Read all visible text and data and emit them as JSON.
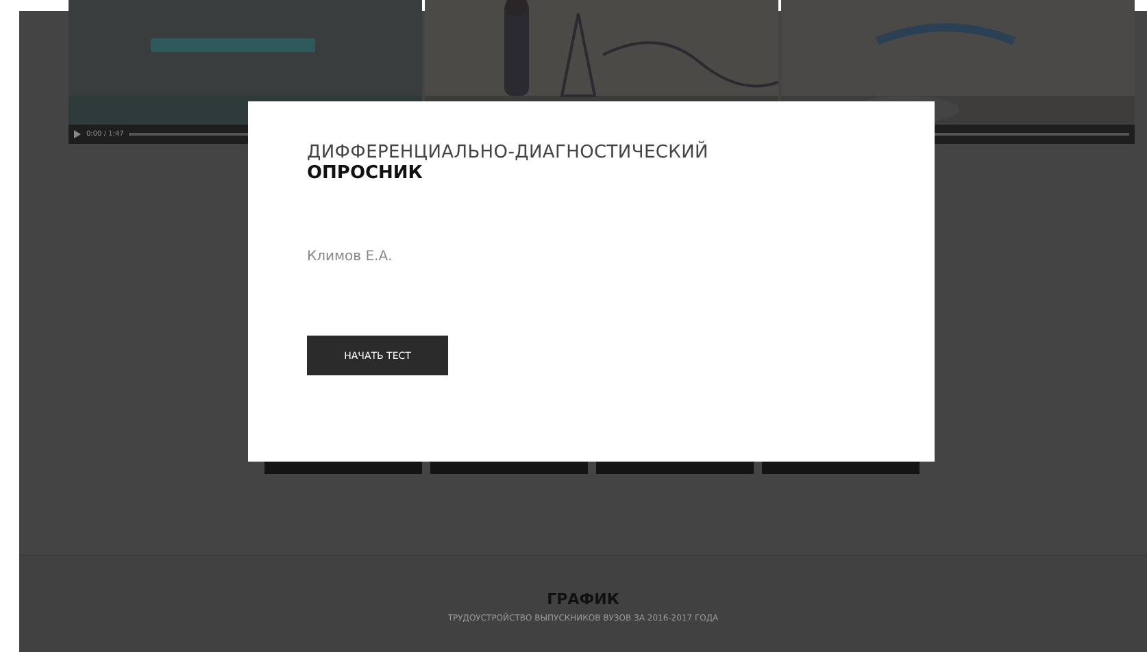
{
  "videos": [
    {
      "kind": "picture",
      "time": "0:00 / 1:47"
    },
    {
      "kind": "picture",
      "controls_visible": false
    },
    {
      "kind": "picture",
      "controls_visible": true
    }
  ],
  "modal": {
    "title": "ДИФФЕРЕНЦИАЛЬНО-ДИАГНОСТИЧЕСКИЙ",
    "title_bold": "ОПРОСНИК",
    "author": "Климов Е.А.",
    "button": "НАЧАТЬ ТЕСТ"
  },
  "footer": {
    "title": "ГРАФИК",
    "subtitle": "ТРУДОУСТРОЙСТВО ВЫПУСКНИКОВ ВУЗОВ ЗА 2016-2017 ГОДА"
  }
}
